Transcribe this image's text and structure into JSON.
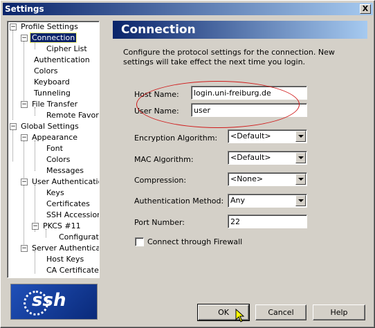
{
  "window": {
    "title": "Settings",
    "close_label": "X"
  },
  "tree": {
    "items": [
      {
        "label": "Profile Settings"
      },
      {
        "label": "Connection"
      },
      {
        "label": "Cipher List"
      },
      {
        "label": "Authentication"
      },
      {
        "label": "Colors"
      },
      {
        "label": "Keyboard"
      },
      {
        "label": "Tunneling"
      },
      {
        "label": "File Transfer"
      },
      {
        "label": "Remote Favorit"
      },
      {
        "label": "Global Settings"
      },
      {
        "label": "Appearance"
      },
      {
        "label": "Font"
      },
      {
        "label": "Colors"
      },
      {
        "label": "Messages"
      },
      {
        "label": "User Authenticatio"
      },
      {
        "label": "Keys"
      },
      {
        "label": "Certificates"
      },
      {
        "label": "SSH Accession"
      },
      {
        "label": "PKCS #11"
      },
      {
        "label": "Configuratio"
      },
      {
        "label": "Server Authenticatio"
      },
      {
        "label": "Host Keys"
      },
      {
        "label": "CA Certificates"
      }
    ]
  },
  "logo": {
    "text": "ssh"
  },
  "panel": {
    "title": "Connection",
    "description": "Configure the protocol settings for the connection. New settings will take effect the next time you login.",
    "host_name_label": "Host Name:",
    "host_name_value": "login.uni-freiburg.de",
    "user_name_label": "User Name:",
    "user_name_value": "user",
    "encryption_label": "Encryption Algorithm:",
    "encryption_value": "<Default>",
    "mac_label": "MAC Algorithm:",
    "mac_value": "<Default>",
    "compression_label": "Compression:",
    "compression_value": "<None>",
    "auth_method_label": "Authentication Method:",
    "auth_method_value": "Any",
    "port_label": "Port Number:",
    "port_value": "22",
    "firewall_label": "Connect through Firewall"
  },
  "buttons": {
    "ok": "OK",
    "cancel": "Cancel",
    "help": "Help"
  }
}
